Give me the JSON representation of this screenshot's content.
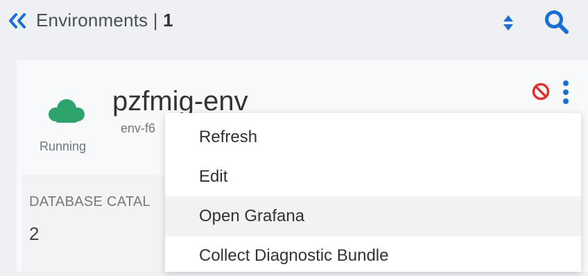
{
  "header": {
    "title": "Environments | ",
    "count": "1"
  },
  "environment": {
    "name": "pzfmig-env",
    "id": "env-f6",
    "status": "Running",
    "stat_label": "DATABASE CATAL",
    "stat_value": "2"
  },
  "menu": {
    "items": [
      {
        "label": "Refresh"
      },
      {
        "label": "Edit"
      },
      {
        "label": "Open Grafana"
      },
      {
        "label": "Collect Diagnostic Bundle"
      }
    ]
  },
  "colors": {
    "accent": "#1a6ed8",
    "running": "#2ea36b",
    "danger": "#e0312f"
  },
  "icons": {
    "collapse": "double-chevron-left-icon",
    "sort": "sort-icon",
    "search": "search-icon",
    "status": "cloud-icon",
    "disable": "disable-icon",
    "more": "more-vertical-icon"
  }
}
